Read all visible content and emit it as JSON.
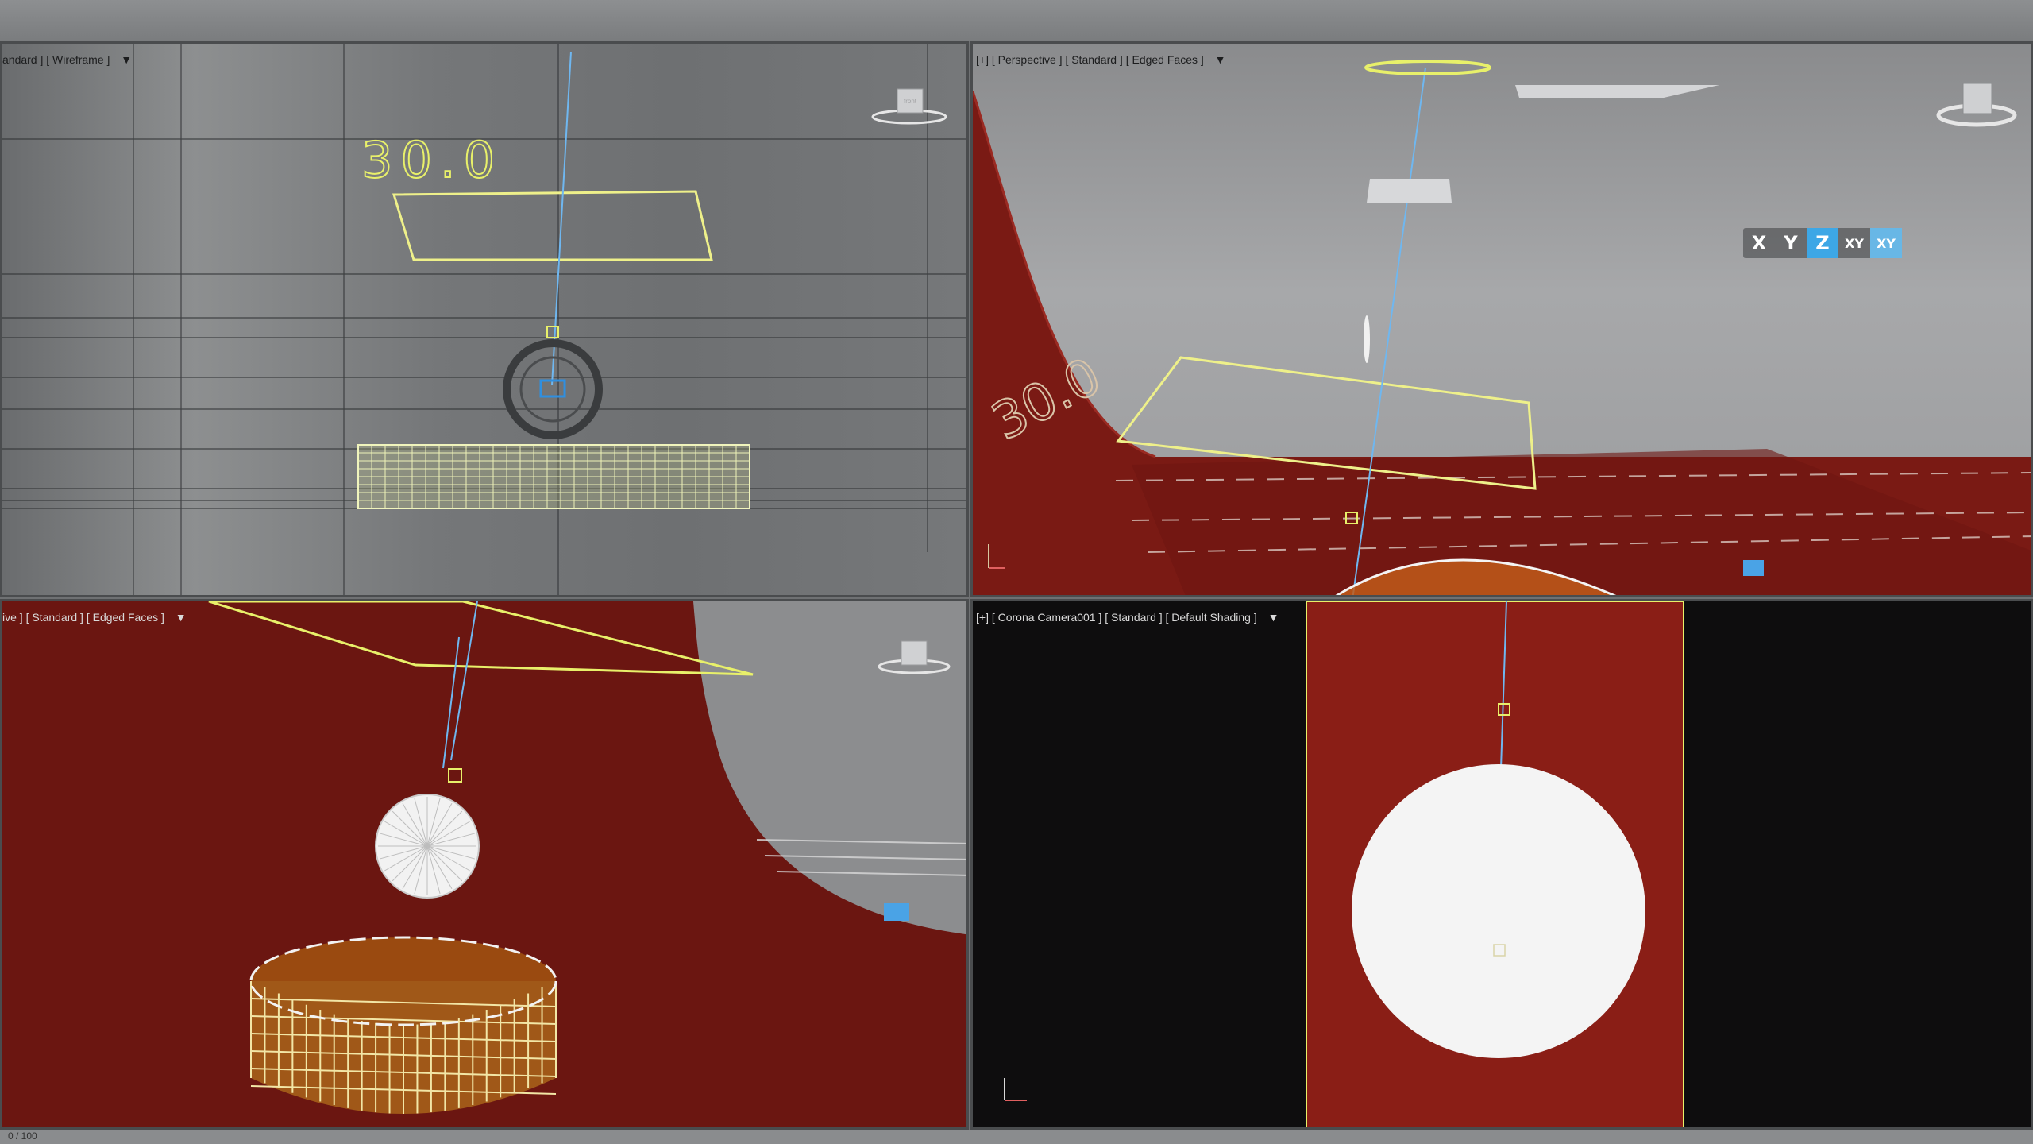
{
  "viewports": {
    "top": {
      "label": "andard ] [ Wireframe ]",
      "text3d": "30.0"
    },
    "perspective": {
      "label": "[+] [ Perspective ] [ Standard ] [ Edged Faces ]",
      "axis_constraints": [
        "X",
        "Y",
        "Z",
        "XY",
        "XY"
      ],
      "active_axis": "Z",
      "text3d": "30.0"
    },
    "left": {
      "label": "ive ] [ Standard ] [ Edged Faces ]"
    },
    "camera": {
      "label": "[+] [ Corona Camera001 ] [ Standard ] [ Default Shading ]"
    }
  },
  "viewcube_face": "front",
  "filter_icon": "funnel-icon",
  "status": {
    "frame": "0 / 100"
  },
  "colors": {
    "backdrop_red": "#7a1a14",
    "selection_yellow": "#e8f06a",
    "gizmo_blue": "#3da7e6"
  }
}
